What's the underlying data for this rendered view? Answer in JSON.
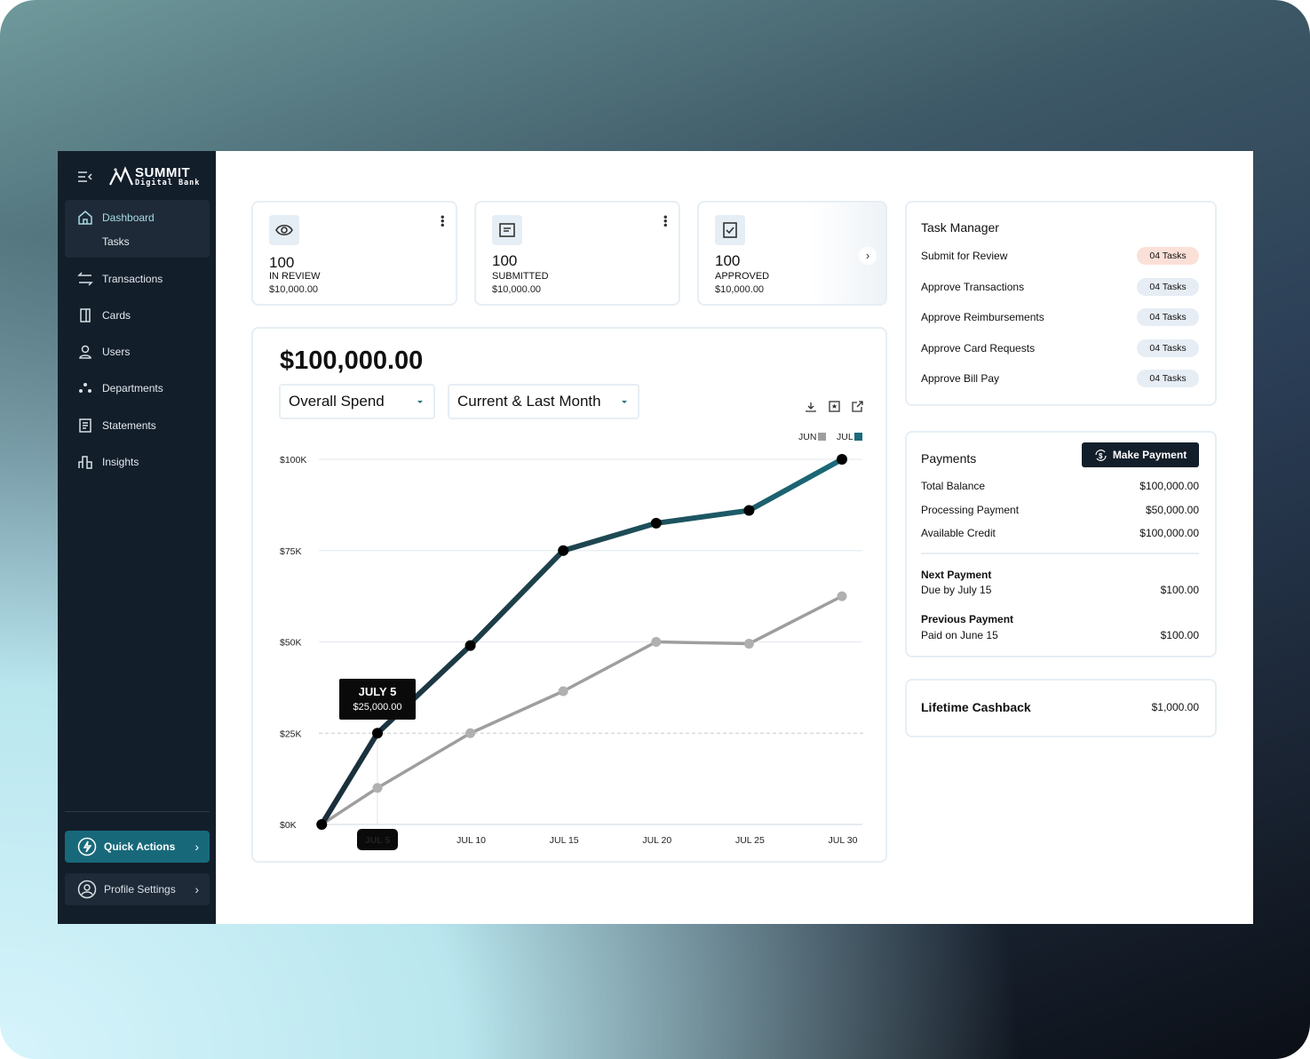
{
  "brand": {
    "name": "SUMMIT",
    "sub": "Digital Bank"
  },
  "sidebar": {
    "items": [
      {
        "label": "Dashboard",
        "icon": "home-icon"
      },
      {
        "label": "Tasks"
      },
      {
        "label": "Transactions",
        "icon": "arrows-swap-icon"
      },
      {
        "label": "Cards",
        "icon": "card-icon"
      },
      {
        "label": "Users",
        "icon": "user-icon"
      },
      {
        "label": "Departments",
        "icon": "departments-icon"
      },
      {
        "label": "Statements",
        "icon": "statement-icon"
      },
      {
        "label": "Insights",
        "icon": "bar-chart-icon"
      }
    ],
    "quick_actions": "Quick Actions",
    "profile_settings": "Profile Settings"
  },
  "kpis": [
    {
      "value": "100",
      "label": "IN REVIEW",
      "amount": "$10,000.00",
      "icon": "eye-icon"
    },
    {
      "value": "100",
      "label": "SUBMITTED",
      "amount": "$10,000.00",
      "icon": "document-icon"
    },
    {
      "value": "100",
      "label": "APPROVED",
      "amount": "$10,000.00",
      "icon": "checkbox-icon"
    }
  ],
  "spend": {
    "total": "$100,000.00",
    "metric": "Overall Spend",
    "period": "Current & Last Month"
  },
  "chart_data": {
    "type": "line",
    "x_ticks": [
      "JUL 5",
      "JUL 10",
      "JUL 15",
      "JUL 20",
      "JUL 25",
      "JUL 30"
    ],
    "x_days": [
      2,
      5,
      10,
      15,
      20,
      25,
      30
    ],
    "y_ticks": [
      "$0K",
      "$25K",
      "$50K",
      "$75K",
      "$100K"
    ],
    "ylim": [
      0,
      100
    ],
    "y_unit": "$K",
    "grid": true,
    "legend_position": "top-right",
    "series": [
      {
        "name": "JUN",
        "color": "#9e9e9e",
        "values": [
          0,
          10,
          25,
          36.5,
          50,
          49.5,
          62.5
        ]
      },
      {
        "name": "JUL",
        "color": "#1b6b7a",
        "values": [
          0,
          25,
          49,
          75,
          82.5,
          86,
          100
        ]
      }
    ],
    "tooltip": {
      "title": "JULY 5",
      "value": "$25,000.00"
    },
    "highlight_tick": "JUL 5"
  },
  "tasks": {
    "title": "Task Manager",
    "items": [
      {
        "label": "Submit for Review",
        "count": "04 Tasks",
        "color": "#fbe0d8"
      },
      {
        "label": "Approve Transactions",
        "count": "04 Tasks",
        "color": "#e6edf4"
      },
      {
        "label": "Approve Reimbursements",
        "count": "04 Tasks",
        "color": "#e6edf4"
      },
      {
        "label": "Approve Card Requests",
        "count": "04 Tasks",
        "color": "#e6edf4"
      },
      {
        "label": "Approve Bill Pay",
        "count": "04 Tasks",
        "color": "#e6edf4"
      }
    ]
  },
  "payments": {
    "title": "Payments",
    "button": "Make Payment",
    "rows": [
      {
        "label": "Total Balance",
        "value": "$100,000.00"
      },
      {
        "label": "Processing Payment",
        "value": "$50,000.00"
      },
      {
        "label": "Available Credit",
        "value": "$100,000.00"
      }
    ],
    "next": {
      "title": "Next Payment",
      "sub": "Due by July 15",
      "value": "$100.00"
    },
    "previous": {
      "title": "Previous Payment",
      "sub": "Paid on June 15",
      "value": "$100.00"
    }
  },
  "cashback": {
    "label": "Lifetime Cashback",
    "value": "$1,000.00"
  }
}
